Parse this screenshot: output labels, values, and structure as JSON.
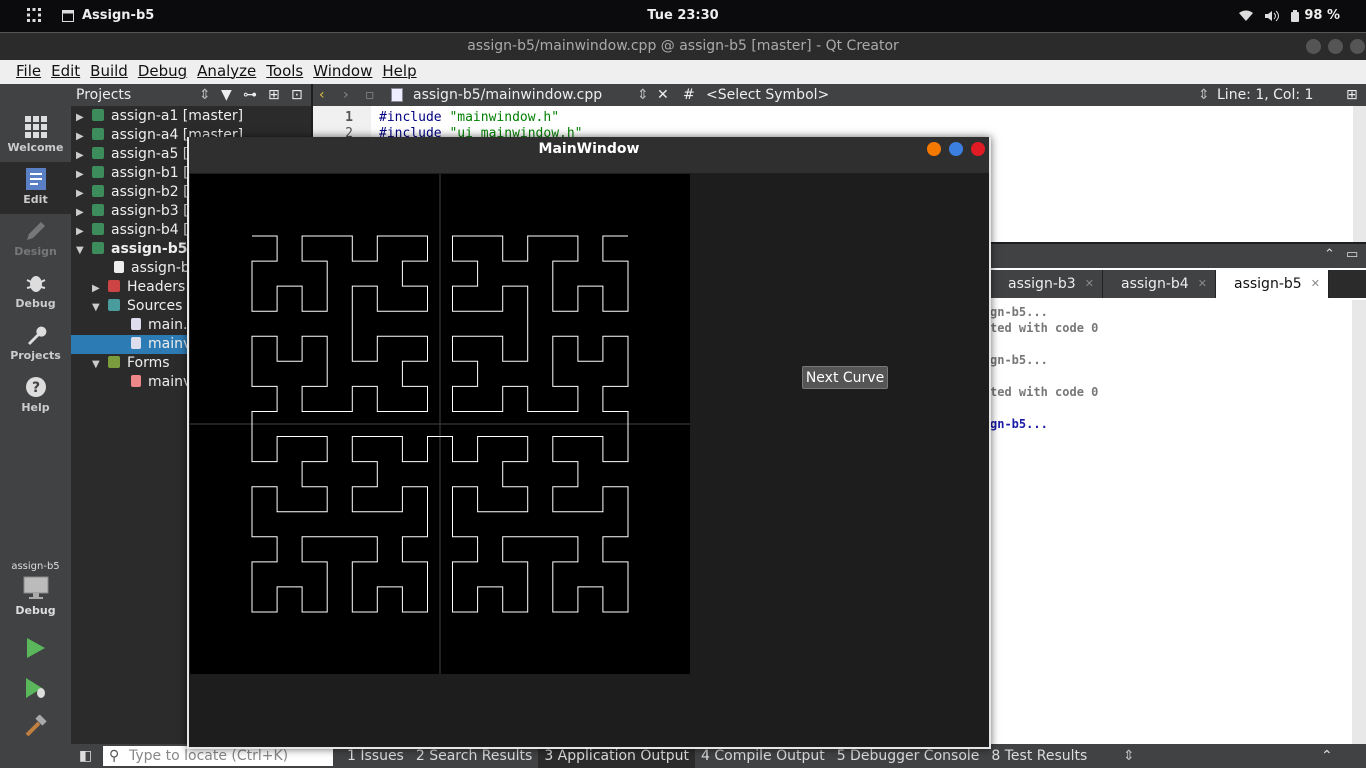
{
  "gnome": {
    "app_name": "Assign-b5",
    "clock": "Tue 23:30",
    "battery": "98 %"
  },
  "window": {
    "title": "assign-b5/mainwindow.cpp @ assign-b5 [master] - Qt Creator"
  },
  "menu": [
    "File",
    "Edit",
    "Build",
    "Debug",
    "Analyze",
    "Tools",
    "Window",
    "Help"
  ],
  "modes": [
    {
      "label": "Welcome",
      "icon": "grid-icon"
    },
    {
      "label": "Edit",
      "icon": "document-icon"
    },
    {
      "label": "Design",
      "icon": "pencil-icon"
    },
    {
      "label": "Debug",
      "icon": "bug-icon"
    },
    {
      "label": "Projects",
      "icon": "wrench-icon"
    },
    {
      "label": "Help",
      "icon": "question-icon"
    }
  ],
  "kit": {
    "project": "assign-b5",
    "build": "Debug"
  },
  "projects": {
    "header": "Projects",
    "rows": [
      {
        "label": "assign-a1 [master]"
      },
      {
        "label": "assign-a4 [master]"
      },
      {
        "label": "assign-a5 ["
      },
      {
        "label": "assign-b1 ["
      },
      {
        "label": "assign-b2 ["
      },
      {
        "label": "assign-b3 ["
      },
      {
        "label": "assign-b4 ["
      },
      {
        "label": "assign-b5"
      },
      {
        "label": "assign-b"
      },
      {
        "label": "Headers"
      },
      {
        "label": "Sources"
      },
      {
        "label": "main."
      },
      {
        "label": "mainv"
      },
      {
        "label": "Forms"
      },
      {
        "label": "mainv"
      }
    ]
  },
  "editor": {
    "file": "assign-b5/mainwindow.cpp",
    "hash": "#",
    "symbol": "<Select Symbol>",
    "position": "Line: 1, Col: 1",
    "line_numbers": [
      "1",
      "2"
    ],
    "lines": [
      {
        "directive": "#include",
        "arg": "\"mainwindow.h\""
      },
      {
        "directive": "#include",
        "arg": "\"ui_mainwindow.h\""
      }
    ]
  },
  "output": {
    "tabs": [
      "assign-b3",
      "assign-b4",
      "assign-b5"
    ],
    "lines": [
      "gn-b5...",
      "ted with code 0",
      "",
      "gn-b5...",
      "",
      "ted with code 0",
      "",
      "gn-b5..."
    ]
  },
  "statusbar": {
    "locate_placeholder": "Type to locate (Ctrl+K)",
    "tabs": [
      "1  Issues",
      "2  Search Results",
      "3  Application Output",
      "4  Compile Output",
      "5  Debugger Console",
      "8  Test Results"
    ]
  },
  "mainwindow": {
    "title": "MainWindow",
    "button": "Next Curve"
  },
  "chart_data": {
    "type": "line",
    "title": "",
    "xlabel": "",
    "ylabel": "",
    "curve": "hilbert",
    "order": 4,
    "curve_color": "#ffffff",
    "axis_color": "#444444",
    "background": "#000000"
  }
}
